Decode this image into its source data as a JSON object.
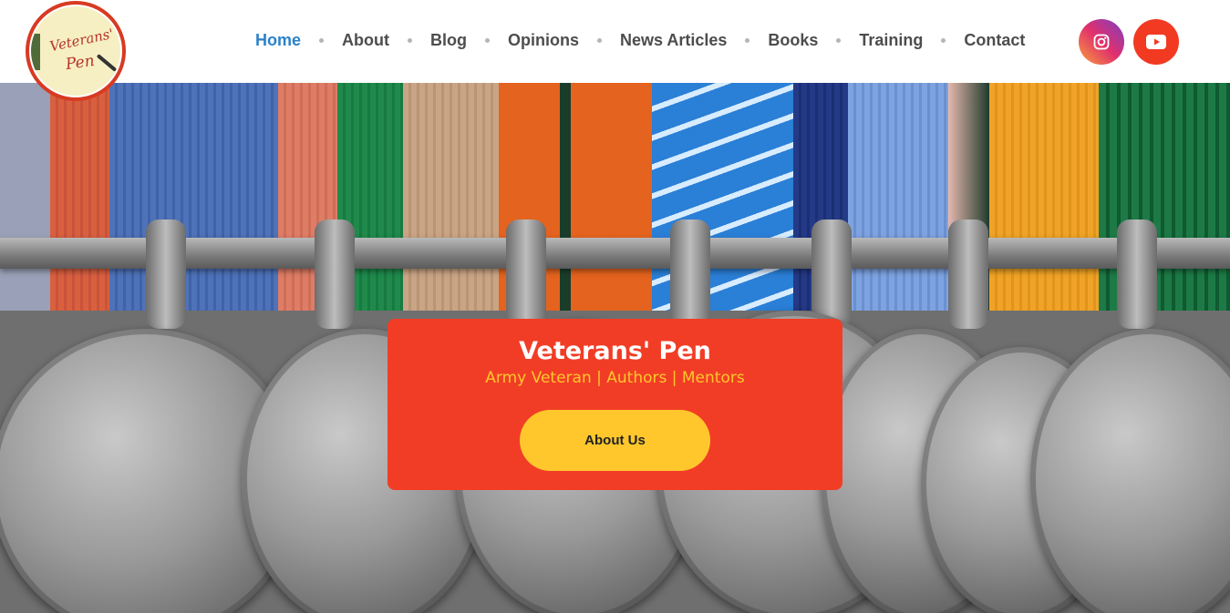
{
  "logo": {
    "line1": "Veterans'",
    "line2": "Pen"
  },
  "nav": {
    "items": [
      {
        "label": "Home",
        "active": true
      },
      {
        "label": "About"
      },
      {
        "label": "Blog"
      },
      {
        "label": "Opinions"
      },
      {
        "label": "News Articles"
      },
      {
        "label": "Books"
      },
      {
        "label": "Training"
      },
      {
        "label": "Contact"
      }
    ]
  },
  "social": {
    "icons": [
      "instagram-icon",
      "youtube-icon"
    ]
  },
  "hero": {
    "title": "Veterans' Pen",
    "subtitle": "Army Veteran | Authors | Mentors",
    "button_label": "About Us"
  },
  "colors": {
    "accent_red": "#f23d26",
    "accent_yellow": "#ffc72c",
    "nav_active": "#2b82c9",
    "nav_text": "#4d4d4d"
  }
}
